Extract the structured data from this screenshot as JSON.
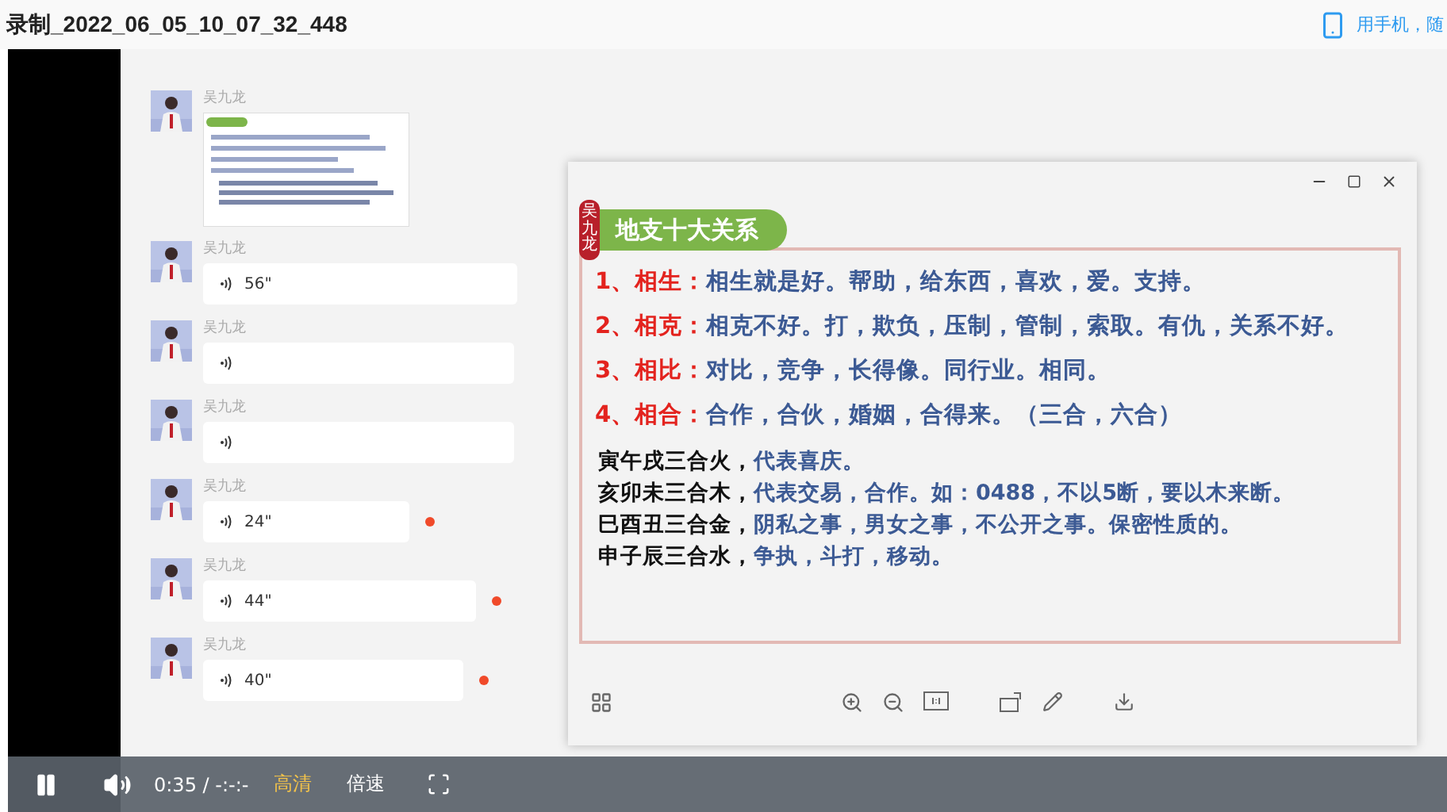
{
  "recording": {
    "title": "录制_2022_06_05_10_07_32_448",
    "phone_link": "用手机，随"
  },
  "chat": {
    "messages": [
      {
        "sender": "吴九龙"
      },
      {
        "kind": "voice",
        "sender": "吴九龙",
        "duration": "56\"",
        "unread": false
      },
      {
        "kind": "voice",
        "sender": "吴九龙",
        "unread": false
      },
      {
        "kind": "voice",
        "sender": "吴九龙",
        "unread": false
      },
      {
        "kind": "voice",
        "sender": "吴九龙",
        "duration": "24\"",
        "unread": true
      },
      {
        "kind": "voice",
        "sender": "吴九龙",
        "duration": "44\"",
        "unread": true
      },
      {
        "kind": "voice",
        "sender": "吴九龙",
        "duration": "40\"",
        "unread": true
      }
    ]
  },
  "viewer": {
    "slide": {
      "tag": "吴九龙",
      "title": "地支十大关系",
      "items": [
        {
          "number": "1、",
          "term": "相生：",
          "text": "相生就是好。帮助，给东西，喜欢，爱。支持。"
        },
        {
          "number": "2、",
          "term": "相克：",
          "text": "相克不好。打，欺负，压制，管制，索取。有仇，关系不好。"
        },
        {
          "number": "3、",
          "term": "相比：",
          "text": "对比，竞争，长得像。同行业。相同。"
        },
        {
          "number": "4、",
          "term": "相合：",
          "text": "合作，合伙，婚姻，合得来。（三合，六合）"
        }
      ],
      "sub_lines": [
        {
          "lead": "寅午戌三合火，",
          "text": "代表喜庆。"
        },
        {
          "lead": "亥卯未三合木，",
          "text": "代表交易，合作。如：0488，不以5断，要以木来断。"
        },
        {
          "lead": "巳酉丑三合金，",
          "text": "阴私之事，男女之事，不公开之事。保密性质的。"
        },
        {
          "lead": "申子辰三合水，",
          "text": "争执，斗打，移动。"
        }
      ]
    }
  },
  "player": {
    "playing": true,
    "time": "0:35",
    "separator": "/",
    "duration": "-:-:-",
    "quality": "高清",
    "speed": "倍速"
  }
}
